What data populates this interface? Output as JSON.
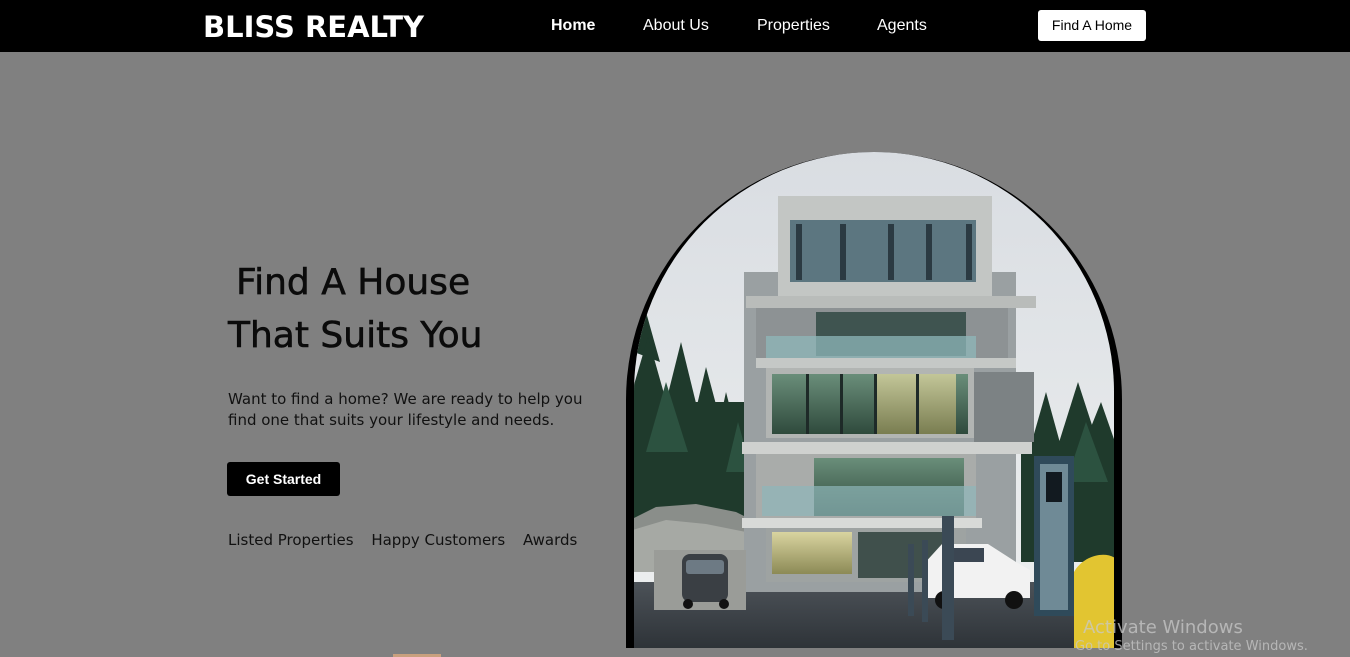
{
  "brand": "BLISS REALTY",
  "nav": {
    "items": [
      {
        "label": "Home",
        "active": true
      },
      {
        "label": "About Us"
      },
      {
        "label": "Properties"
      },
      {
        "label": "Agents"
      }
    ],
    "cta_label": "Find A Home"
  },
  "hero": {
    "title_line1": "Find A House",
    "title_line2": "That Suits You",
    "subtitle": "Want to find a home? We are ready to help you find one that suits your lifestyle and needs.",
    "button_label": "Get Started",
    "stats": [
      "Listed Properties",
      "Happy Customers",
      "Awards"
    ],
    "image_icon": "modern-house-image"
  },
  "watermark": {
    "line1": "Activate Windows",
    "line2": "Go to Settings to activate Windows."
  },
  "colors": {
    "navbar": "#000000",
    "background": "#808080",
    "accent": "#ffffff"
  }
}
